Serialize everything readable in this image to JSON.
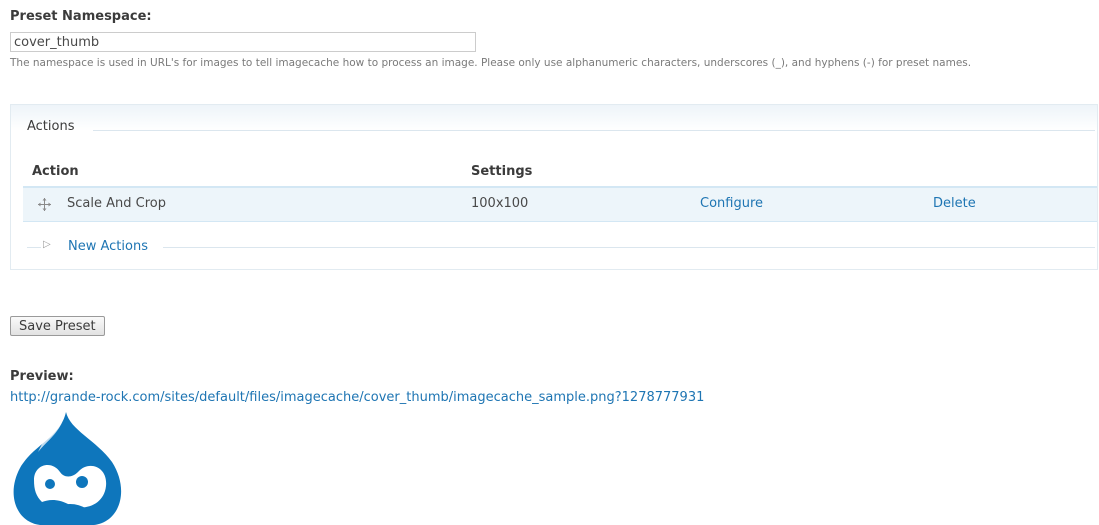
{
  "namespace": {
    "label": "Preset Namespace:",
    "value": "cover_thumb",
    "description": "The namespace is used in URL's for images to tell imagecache how to process an image. Please only use alphanumeric characters, underscores (_), and hyphens (-) for preset names."
  },
  "actions": {
    "legend": "Actions",
    "columns": {
      "action": "Action",
      "settings": "Settings"
    },
    "rows": [
      {
        "action": "Scale And Crop",
        "settings": "100x100",
        "configure": "Configure",
        "delete": "Delete"
      }
    ],
    "new_actions": "New Actions"
  },
  "save_button": "Save Preset",
  "preview": {
    "label": "Preview:",
    "url": "http://grande-rock.com/sites/default/files/imagecache/cover_thumb/imagecache_sample.png?1278777931",
    "image_icon": "drupal-drop-logo"
  },
  "colors": {
    "link": "#1e75b3",
    "row_bg": "#edf5fa",
    "logo_blue": "#0e76bc"
  }
}
